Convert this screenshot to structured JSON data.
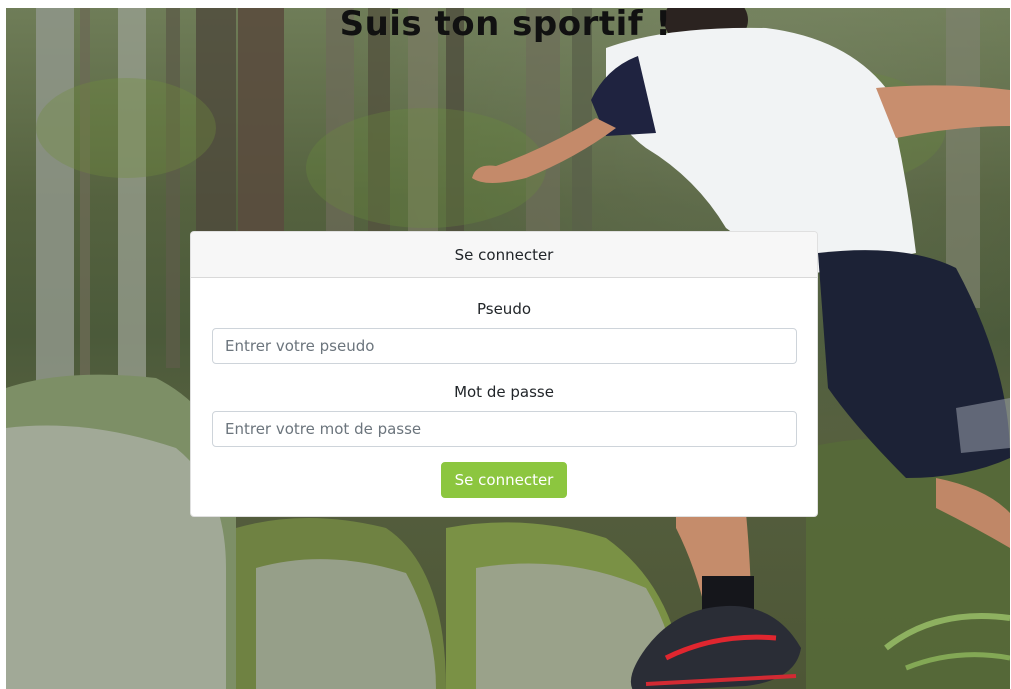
{
  "page": {
    "title": "Suis ton sportif !"
  },
  "login": {
    "header": "Se connecter",
    "pseudo_label": "Pseudo",
    "pseudo_placeholder": "Entrer votre pseudo",
    "password_label": "Mot de passe",
    "password_placeholder": "Entrer votre mot de passe",
    "submit_label": "Se connecter"
  },
  "colors": {
    "submit_button": "#8cc63f",
    "card_header_bg": "#f7f7f7",
    "title_text": "#111111"
  },
  "icons": {
    "background_image": "forest-trail-runner-photo"
  }
}
